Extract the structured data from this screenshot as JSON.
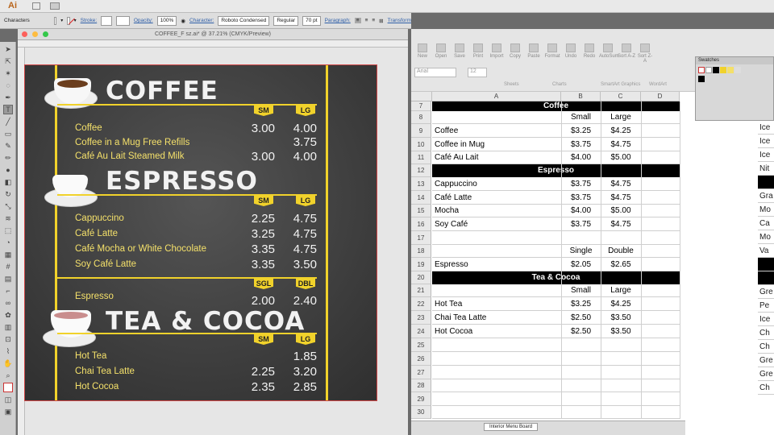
{
  "app": {
    "logo": "Ai"
  },
  "control_bar": {
    "panel_label": "Characters",
    "stroke_label": "Stroke:",
    "opacity_label": "Opacity:",
    "opacity_value": "100%",
    "character_label": "Character:",
    "font_family": "Roboto Condensed",
    "font_style": "Regular",
    "font_size": "70 pt",
    "paragraph_label": "Paragraph:",
    "transform_label": "Transform"
  },
  "document": {
    "title": "COFFEE_F sz.ai* @ 37.21% (CMYK/Preview)"
  },
  "menu": {
    "coffee": {
      "heading": "COFFEE",
      "col1": "SM",
      "col2": "LG",
      "items": [
        {
          "name": "Coffee",
          "p1": "3.00",
          "p2": "4.00"
        },
        {
          "name": "Coffee in a Mug Free Refills",
          "p1": "",
          "p2": "3.75"
        },
        {
          "name": "Café Au Lait Steamed Milk",
          "p1": "3.00",
          "p2": "4.00"
        }
      ]
    },
    "espresso": {
      "heading": "ESPRESSO",
      "col1": "SM",
      "col2": "LG",
      "items": [
        {
          "name": "Cappuccino",
          "p1": "2.25",
          "p2": "4.75"
        },
        {
          "name": "Café  Latte",
          "p1": "3.25",
          "p2": "4.75"
        },
        {
          "name": "Café Mocha or White Chocolate",
          "p1": "3.35",
          "p2": "4.75"
        },
        {
          "name": "Soy Café Latte",
          "p1": "3.35",
          "p2": "3.50"
        }
      ],
      "col3": "SGL",
      "col4": "DBL",
      "single": {
        "name": "Espresso",
        "p1": "2.00",
        "p2": "2.40"
      }
    },
    "tea": {
      "heading": "TEA & COCOA",
      "col1": "SM",
      "col2": "LG",
      "items": [
        {
          "name": "Hot Tea",
          "p1": "",
          "p2": "1.85"
        },
        {
          "name": "Chai Tea Latte",
          "p1": "2.25",
          "p2": "3.20"
        },
        {
          "name": "Hot Cocoa",
          "p1": "2.35",
          "p2": "2.85"
        }
      ]
    }
  },
  "excel": {
    "ribbon": [
      "New",
      "Open",
      "Save",
      "Print",
      "Import",
      "Copy",
      "Paste",
      "Format",
      "Undo",
      "Redo",
      "AutoSum",
      "Sort A-Z",
      "Sort Z-A"
    ],
    "ribbon_tabs": [
      "Sheets",
      "Charts",
      "SmartArt Graphics",
      "WordArt"
    ],
    "font_name": "Arial",
    "font_size": "12",
    "columns": [
      "A",
      "B",
      "C",
      "D"
    ],
    "rows": [
      {
        "n": "7",
        "type": "band",
        "a": "Coffee"
      },
      {
        "n": "8",
        "a": "",
        "b": "Small",
        "c": "Large"
      },
      {
        "n": "9",
        "a": "Coffee",
        "b": "$3.25",
        "c": "$4.25"
      },
      {
        "n": "10",
        "a": "Coffee in Mug",
        "b": "$3.75",
        "c": "$4.75"
      },
      {
        "n": "11",
        "a": "Café Au Lait",
        "b": "$4.00",
        "c": "$5.00"
      },
      {
        "n": "12",
        "type": "band",
        "a": "Espresso"
      },
      {
        "n": "13",
        "a": "Cappuccino",
        "b": "$3.75",
        "c": "$4.75"
      },
      {
        "n": "14",
        "a": "Café Latte",
        "b": "$3.75",
        "c": "$4.75"
      },
      {
        "n": "15",
        "a": "Mocha",
        "b": "$4.00",
        "c": "$5.00"
      },
      {
        "n": "16",
        "a": "Soy Café",
        "b": "$3.75",
        "c": "$4.75"
      },
      {
        "n": "17",
        "a": "",
        "b": "",
        "c": ""
      },
      {
        "n": "18",
        "a": "",
        "b": "Single",
        "c": "Double"
      },
      {
        "n": "19",
        "a": "Espresso",
        "b": "$2.05",
        "c": "$2.65"
      },
      {
        "n": "20",
        "type": "band",
        "a": "Tea & Cocoa"
      },
      {
        "n": "21",
        "a": "",
        "b": "Small",
        "c": "Large"
      },
      {
        "n": "22",
        "a": "Hot Tea",
        "b": "$3.25",
        "c": "$4.25"
      },
      {
        "n": "23",
        "a": "Chai Tea Latte",
        "b": "$2.50",
        "c": "$3.50"
      },
      {
        "n": "24",
        "a": "Hot Cocoa",
        "b": "$2.50",
        "c": "$3.50"
      },
      {
        "n": "25",
        "a": "",
        "b": "",
        "c": ""
      },
      {
        "n": "26",
        "a": "",
        "b": "",
        "c": ""
      },
      {
        "n": "27",
        "a": "",
        "b": "",
        "c": ""
      },
      {
        "n": "28",
        "a": "",
        "b": "",
        "c": ""
      },
      {
        "n": "29",
        "a": "",
        "b": "",
        "c": ""
      },
      {
        "n": "30",
        "a": "",
        "b": "",
        "c": ""
      }
    ],
    "sheet_tab": "Interior Menu Board",
    "side_cells": [
      "Ice",
      "Ice",
      "Ice",
      "Nit",
      "",
      "Gra",
      "Mo",
      "Ca",
      "Mo",
      "Va",
      "",
      "",
      "Gre",
      "Pe",
      "Ice",
      "Ch",
      "Ch",
      "Gre",
      "Gre",
      "Ch"
    ]
  },
  "swatches": {
    "title": "Swatches"
  }
}
